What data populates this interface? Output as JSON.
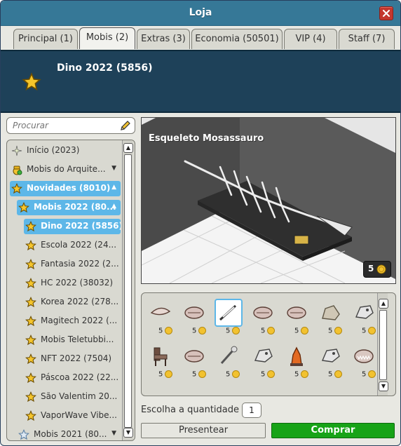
{
  "window": {
    "title": "Loja"
  },
  "tabs": [
    {
      "label": "Principal (1)"
    },
    {
      "label": "Mobis (2)"
    },
    {
      "label": "Extras (3)"
    },
    {
      "label": "Economia (50501)"
    },
    {
      "label": "VIP (4)"
    },
    {
      "label": "Staff (7)"
    }
  ],
  "active_tab": "Mobis (2)",
  "header": {
    "title": "Dino 2022 (5856)",
    "icon": "star-icon"
  },
  "search": {
    "placeholder": "Procurar",
    "value": ""
  },
  "tree": [
    {
      "label": "Início (2023)",
      "icon": "sparkle-icon"
    },
    {
      "label": "Mobis do Arquite...",
      "icon": "builder-icon",
      "arrow": "down"
    },
    {
      "label": "Novidades (8010)",
      "icon": "star-icon",
      "arrow": "up",
      "selected": true
    },
    {
      "label": "Mobis 2022 (80...",
      "icon": "star-icon",
      "arrow": "up",
      "selected": true
    },
    {
      "label": "Dino 2022 (5856)",
      "icon": "star-icon",
      "selected": true
    },
    {
      "label": "Escola 2022 (24...",
      "icon": "star-icon"
    },
    {
      "label": "Fantasia 2022 (2...",
      "icon": "star-icon"
    },
    {
      "label": "HC 2022 (38032)",
      "icon": "star-icon"
    },
    {
      "label": "Korea 2022 (278...",
      "icon": "star-icon"
    },
    {
      "label": "Magitech 2022 (...",
      "icon": "star-icon"
    },
    {
      "label": "Mobis Teletubbi...",
      "icon": "star-icon"
    },
    {
      "label": "NFT 2022 (7504)",
      "icon": "star-icon"
    },
    {
      "label": "Páscoa 2022 (22...",
      "icon": "star-icon"
    },
    {
      "label": "São Valentim 20...",
      "icon": "star-icon"
    },
    {
      "label": "VaporWave Vibe...",
      "icon": "star-icon"
    },
    {
      "label": "Mobis 2021 (80...",
      "icon": "star-outline-icon",
      "arrow": "down"
    }
  ],
  "preview": {
    "title": "Esqueleto Mosassauro",
    "price": "5"
  },
  "grid": [
    {
      "item": "jaw-fossil",
      "price": "5"
    },
    {
      "item": "ribcage-fossil",
      "price": "5"
    },
    {
      "item": "skeleton-fossil",
      "price": "5",
      "selected": true
    },
    {
      "item": "ribcage-fossil",
      "price": "5"
    },
    {
      "item": "ribcage-fossil",
      "price": "5"
    },
    {
      "item": "rock-fossil",
      "price": "5"
    },
    {
      "item": "skull-fossil",
      "price": "5"
    },
    {
      "item": "chair-fossil",
      "price": "5"
    },
    {
      "item": "ribcage-fossil",
      "price": "5"
    },
    {
      "item": "bone-fossil",
      "price": "5"
    },
    {
      "item": "skull-fossil",
      "price": "5"
    },
    {
      "item": "lava-fossil",
      "price": "5"
    },
    {
      "item": "skull-fossil",
      "price": "5"
    },
    {
      "item": "teeth-fossil",
      "price": "5"
    }
  ],
  "quantity": {
    "label": "Escolha a quantidade",
    "value": "1"
  },
  "buttons": {
    "gift": "Presentear",
    "buy": "Comprar"
  },
  "colors": {
    "titlebar": "#367897",
    "header": "#1E4159",
    "selected": "#5DB7E8",
    "buy": "#17A317"
  }
}
